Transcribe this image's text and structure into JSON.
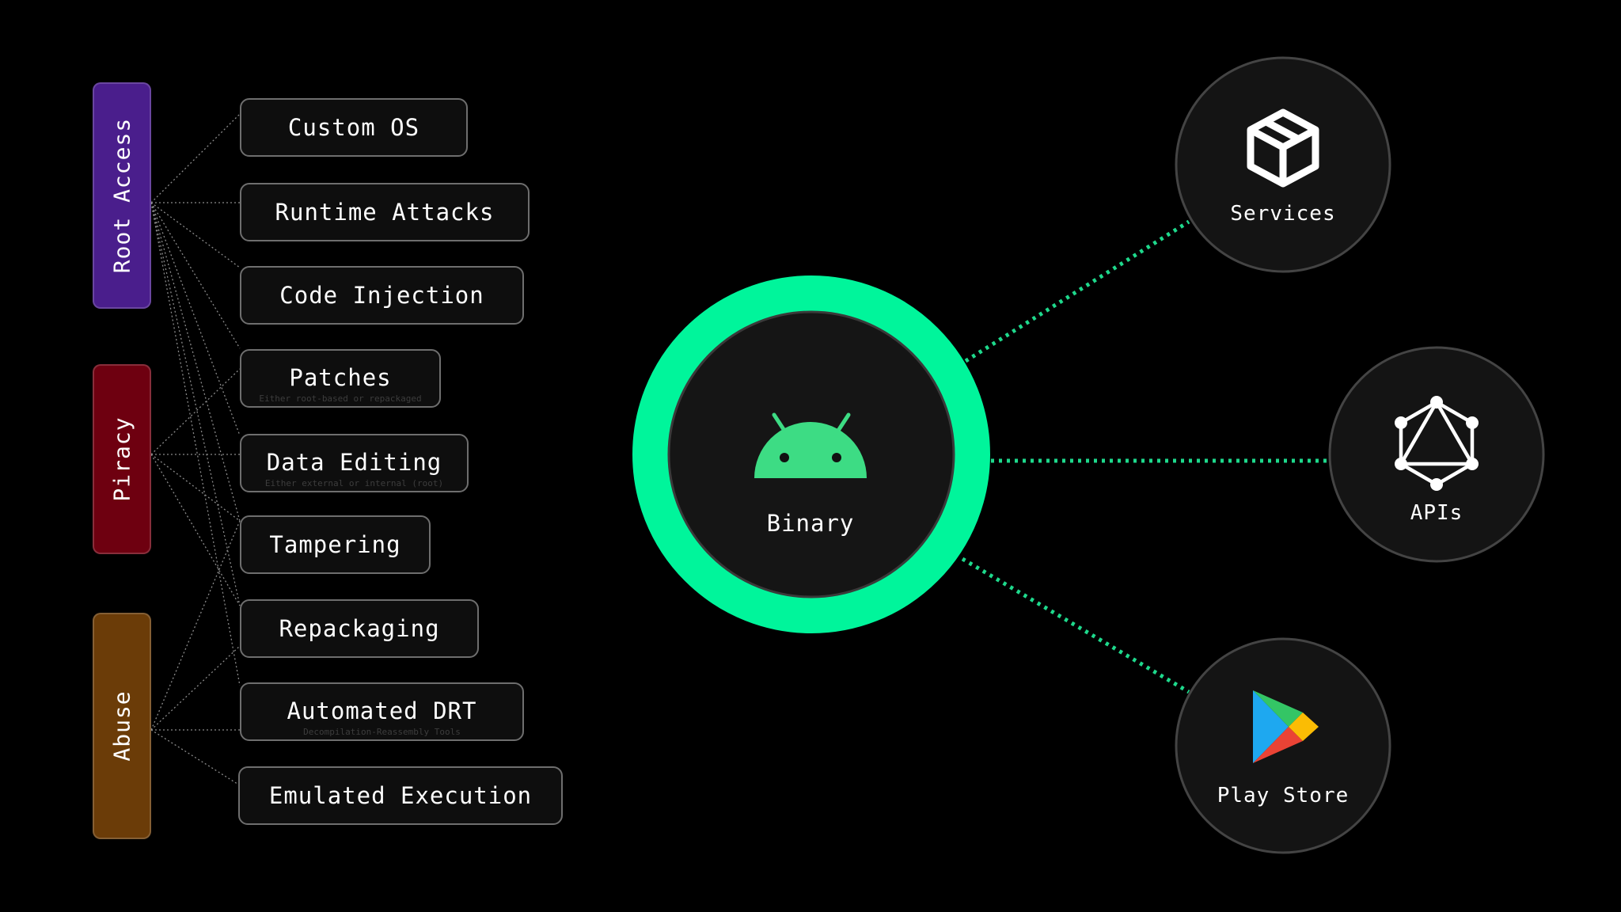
{
  "categories": [
    {
      "id": "root",
      "label": "Root Access",
      "color": "#4a1e8c"
    },
    {
      "id": "piracy",
      "label": "Piracy",
      "color": "#6e0010"
    },
    {
      "id": "abuse",
      "label": "Abuse",
      "color": "#6b3c08"
    }
  ],
  "attacks": [
    {
      "label": "Custom OS",
      "sub": ""
    },
    {
      "label": "Runtime Attacks",
      "sub": ""
    },
    {
      "label": "Code Injection",
      "sub": ""
    },
    {
      "label": "Patches",
      "sub": "Either root-based or repackaged"
    },
    {
      "label": "Data Editing",
      "sub": "Either external or internal (root)"
    },
    {
      "label": "Tampering",
      "sub": ""
    },
    {
      "label": "Repackaging",
      "sub": ""
    },
    {
      "label": "Automated DRT",
      "sub": "Decompilation-Reassembly Tools"
    },
    {
      "label": "Emulated Execution",
      "sub": ""
    }
  ],
  "center": {
    "label": "Binary",
    "icon": "android-icon",
    "ring_color": "#00f59b"
  },
  "targets": [
    {
      "label": "Services",
      "icon": "box-icon"
    },
    {
      "label": "APIs",
      "icon": "graphql-icon"
    },
    {
      "label": "Play Store",
      "icon": "play-store-icon"
    }
  ],
  "colors": {
    "background": "#000000",
    "connector": "#1ed98c",
    "android_green": "#3ddc84"
  }
}
